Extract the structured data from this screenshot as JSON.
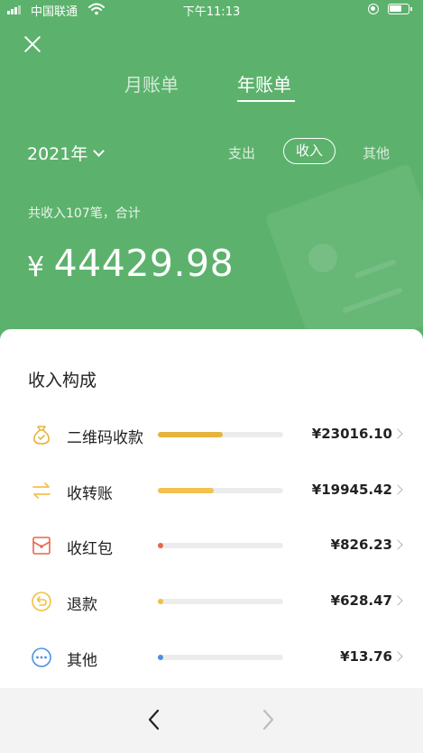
{
  "status_bar": {
    "carrier": "中国联通",
    "time": "下午11:13"
  },
  "tabs": [
    {
      "label": "月账单",
      "active": false
    },
    {
      "label": "年账单",
      "active": true
    }
  ],
  "year_selector": {
    "label": "2021年"
  },
  "filters": [
    {
      "label": "支出",
      "active": false
    },
    {
      "label": "收入",
      "active": true
    },
    {
      "label": "其他",
      "active": false
    }
  ],
  "summary": {
    "text": "共收入107笔，合计",
    "currency": "¥",
    "total": "44429.98"
  },
  "breakdown": {
    "title": "收入构成",
    "items": [
      {
        "label": "二维码收款",
        "amount": "¥23016.10",
        "fraction": 0.518,
        "color": "#e6b43c",
        "icon": "money-bag-icon"
      },
      {
        "label": "收转账",
        "amount": "¥19945.42",
        "fraction": 0.449,
        "color": "#f2c14e",
        "icon": "transfer-icon"
      },
      {
        "label": "收红包",
        "amount": "¥826.23",
        "fraction": 0.019,
        "color": "#e8674a",
        "icon": "red-envelope-icon"
      },
      {
        "label": "退款",
        "amount": "¥628.47",
        "fraction": 0.014,
        "color": "#f0c040",
        "icon": "refund-icon"
      },
      {
        "label": "其他",
        "amount": "¥13.76",
        "fraction": 0.0003,
        "color": "#4a90e2",
        "icon": "more-icon"
      }
    ]
  },
  "colors": {
    "header_green": "#5cb26c",
    "card_bg": "#ffffff",
    "page_bg": "#f3f3f3"
  }
}
